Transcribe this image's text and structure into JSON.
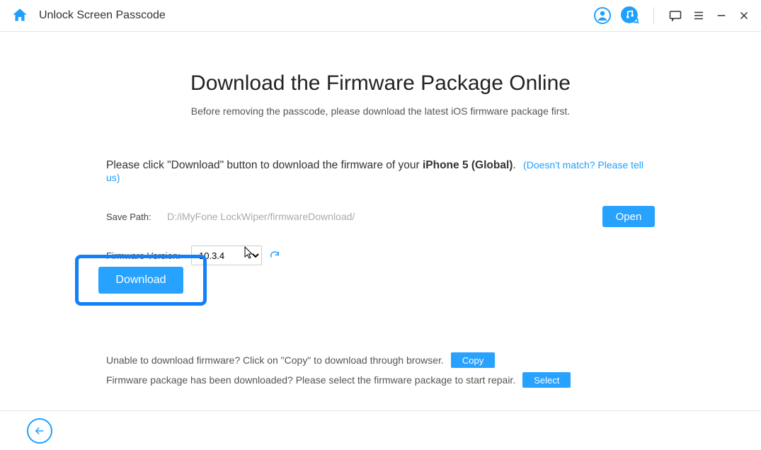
{
  "titlebar": {
    "title": "Unlock Screen Passcode"
  },
  "main": {
    "heading": "Download the Firmware Package Online",
    "subheading": "Before removing the passcode, please download the latest iOS firmware package first.",
    "instruction_prefix": "Please click \"Download\" button to download the firmware of your ",
    "device": "iPhone 5 (Global)",
    "instruction_suffix": ".",
    "mismatch_link": "(Doesn't match? Please tell us)",
    "save_path_label": "Save Path:",
    "save_path_value": "D:/iMyFone LockWiper/firmwareDownload/",
    "open_label": "Open",
    "firmware_label": "Firmware Version:",
    "firmware_value": "10.3.4",
    "download_label": "Download"
  },
  "bottom": {
    "line1_text": "Unable to download firmware? Click on \"Copy\" to download through browser.",
    "copy_label": "Copy",
    "line2_text": "Firmware package has been downloaded? Please select the firmware package to start repair.",
    "select_label": "Select"
  }
}
